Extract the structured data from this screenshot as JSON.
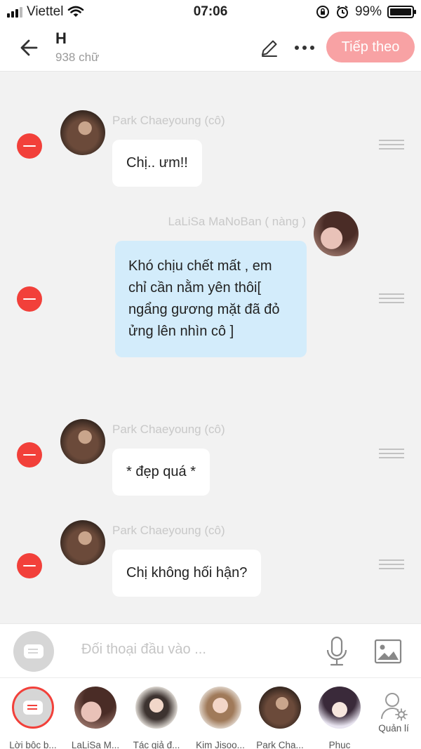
{
  "status_bar": {
    "carrier": "Viettel",
    "time": "07:06",
    "battery": "99%",
    "battery_level": 0.99,
    "icons": [
      "signal-icon",
      "wifi-icon",
      "rotation-lock-icon",
      "alarm-icon",
      "battery-icon"
    ]
  },
  "header": {
    "title": "H",
    "subtitle": "938 chữ",
    "next_label": "Tiếp theo",
    "icons": [
      "back-arrow-icon",
      "pencil-icon",
      "more-icon"
    ]
  },
  "messages": [
    {
      "speaker": "Park Chaeyoung (cô)",
      "text": "Chị.. ưm!!",
      "side": "left"
    },
    {
      "speaker": "LaLiSa MaNoBan ( nàng )",
      "text": "Khó chịu chết mất , em chỉ cần nằm yên thôi[ ngẩng gương mặt đã đỏ ửng lên nhìn cô ]",
      "side": "right"
    },
    {
      "speaker": "Park Chaeyoung (cô)",
      "text": "* đẹp quá *",
      "side": "left"
    },
    {
      "speaker": "Park Chaeyoung (cô)",
      "text": "Chị không hối hận?",
      "side": "left"
    }
  ],
  "input": {
    "placeholder": "Đối thoại đầu vào ..."
  },
  "characters": [
    {
      "label": "Lời bộc b..."
    },
    {
      "label": "LaLiSa M..."
    },
    {
      "label": "Tác giả đ..."
    },
    {
      "label": "Kim Jisoo..."
    },
    {
      "label": "Park Cha..."
    },
    {
      "label": "Phục"
    }
  ],
  "manage_label": "Quản lí",
  "colors": {
    "accent_red": "#f2403a",
    "next_button": "#f8a2a4",
    "bubble_blue": "#d3ecfb",
    "background": "#f2f2f2"
  }
}
